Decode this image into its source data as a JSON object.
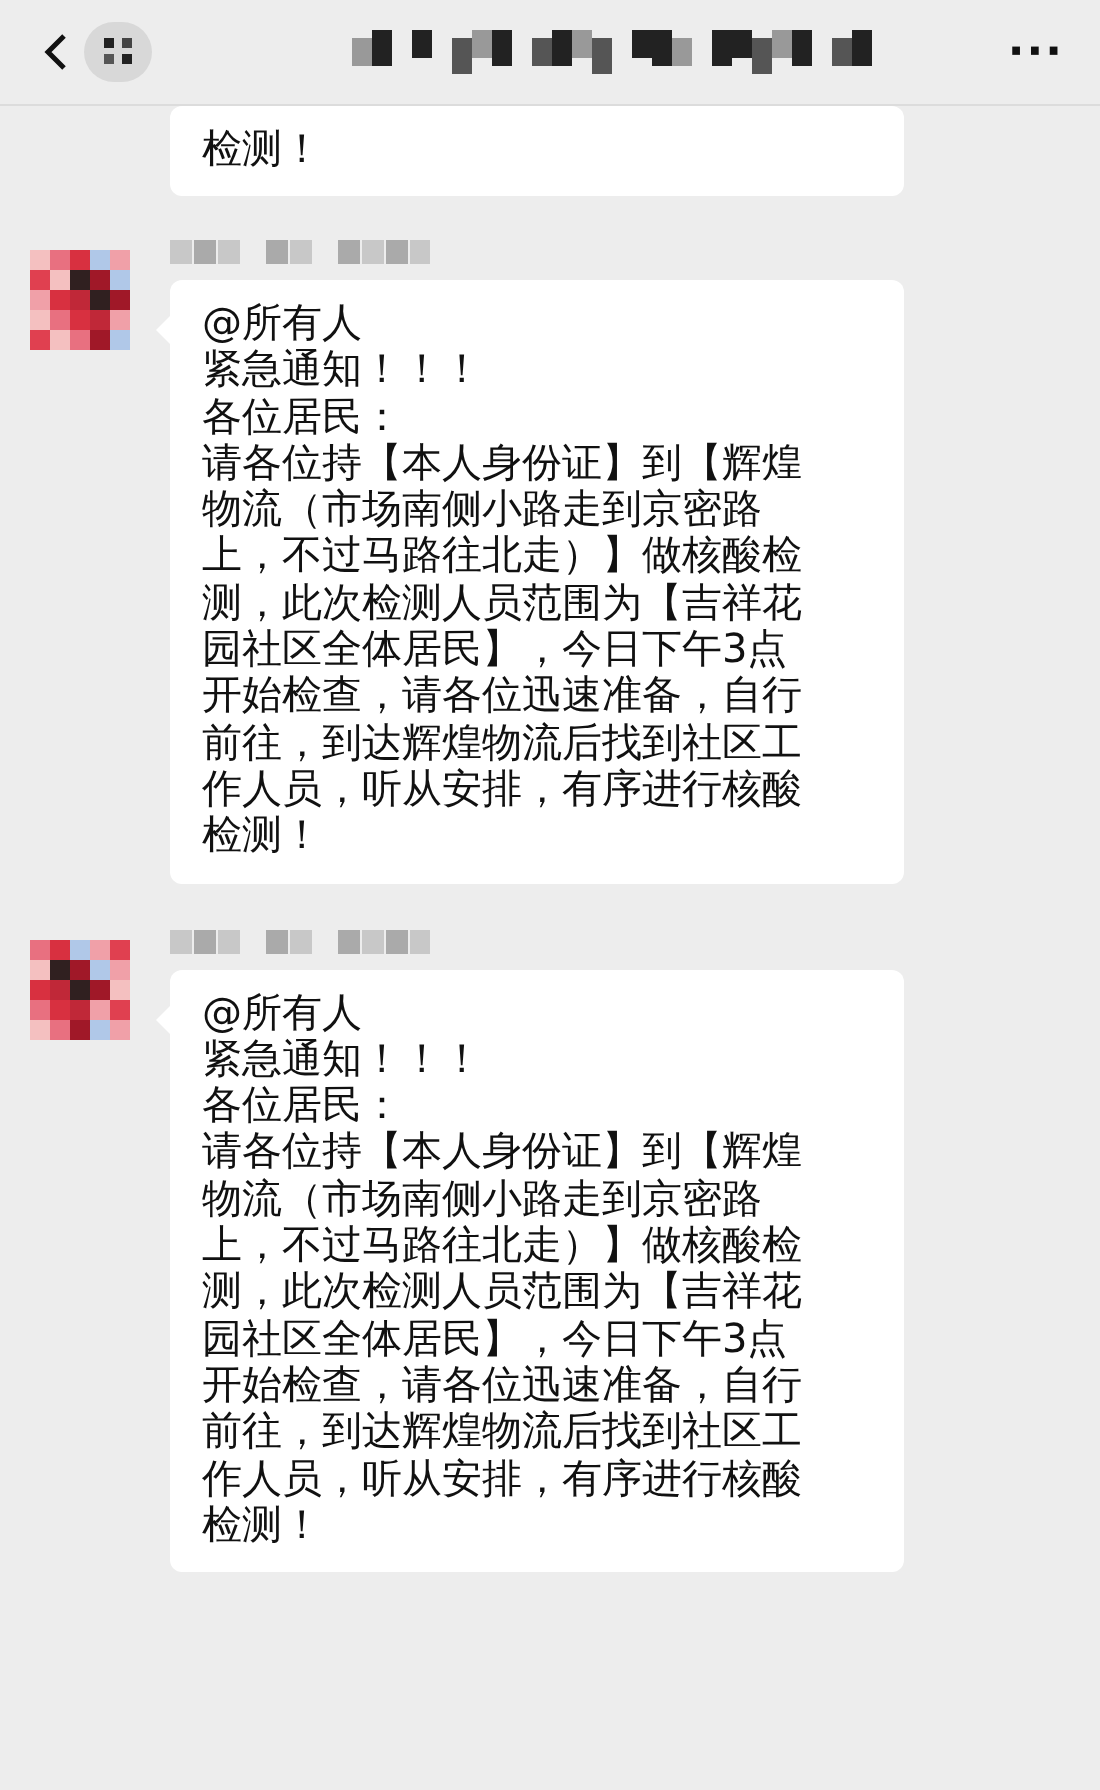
{
  "header": {
    "more": "···"
  },
  "partial_message": {
    "lines": [
      "检测！"
    ]
  },
  "messages": [
    {
      "lines": [
        "@所有人",
        "紧急通知！！！",
        "各位居民：",
        "请各位持【本人身份证】到【辉煌",
        "物流（市场南侧小路走到京密路",
        "上，不过马路往北走）】做核酸检",
        "测，此次检测人员范围为【吉祥花",
        "园社区全体居民】，今日下午3点",
        "开始检查，请各位迅速准备，自行",
        "前往，到达辉煌物流后找到社区工",
        "作人员，听从安排，有序进行核酸",
        "检测！"
      ]
    },
    {
      "lines": [
        "@所有人",
        "紧急通知！！！",
        "各位居民：",
        "请各位持【本人身份证】到【辉煌",
        "物流（市场南侧小路走到京密路",
        "上，不过马路往北走）】做核酸检",
        "测，此次检测人员范围为【吉祥花",
        "园社区全体居民】，今日下午3点",
        "开始检查，请各位迅速准备，自行",
        "前往，到达辉煌物流后找到社区工",
        "作人员，听从安排，有序进行核酸",
        "检测！"
      ]
    }
  ]
}
